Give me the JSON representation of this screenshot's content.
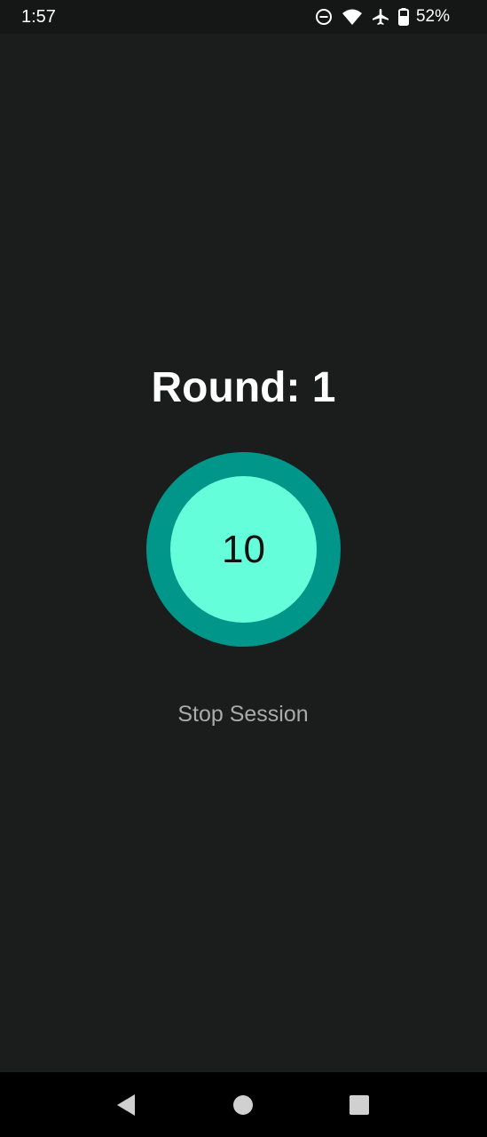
{
  "status_bar": {
    "time": "1:57",
    "battery_percent": "52%",
    "icons": [
      "do-not-disturb-icon",
      "wifi-icon",
      "airplane-mode-icon",
      "battery-icon"
    ]
  },
  "session": {
    "round_label": "Round: 1",
    "timer_value": "10",
    "stop_label": "Stop Session"
  },
  "colors": {
    "background": "#1b1d1d",
    "ring_outer": "#00968a",
    "ring_inner": "#64ffda",
    "stop_text": "#a9abab"
  },
  "nav_bar": {
    "buttons": [
      "back-icon",
      "home-icon",
      "recents-icon"
    ]
  }
}
